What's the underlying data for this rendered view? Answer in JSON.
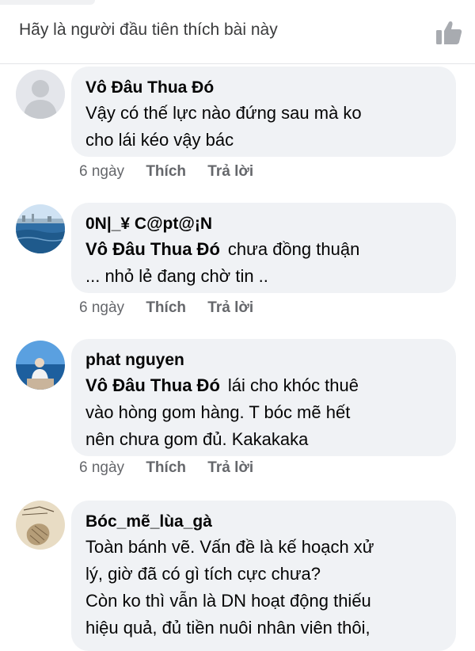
{
  "header": {
    "first_like_text": "Hãy là người đầu tiên thích bài này",
    "like_icon": "thumbs-up-icon"
  },
  "comments": [
    {
      "author": "Vô Đâu Thua Đó",
      "mention": "",
      "lines": [
        "Vậy có thế lực nào đứng sau mà ko",
        "cho lái kéo vậy bác"
      ],
      "time": "6 ngày",
      "like_label": "Thích",
      "reply_label": "Trả lời",
      "avatar_icon": "default-profile-icon"
    },
    {
      "author": "0N|_¥ C@pt@¡N",
      "mention": "Vô Đâu Thua Đó",
      "lines": [
        "chưa đồng thuận",
        "... nhỏ lẻ đang chờ tin .."
      ],
      "time": "6 ngày",
      "like_label": "Thích",
      "reply_label": "Trả lời",
      "avatar_icon": "sea-landscape-avatar"
    },
    {
      "author": "phat nguyen",
      "mention": "Vô Đâu Thua Đó",
      "lines": [
        "lái cho khóc thuê",
        "vào hòng gom hàng. T bóc mẽ hết",
        "nên chưa gom đủ. Kakakaka"
      ],
      "time": "6 ngày",
      "like_label": "Thích",
      "reply_label": "Trả lời",
      "avatar_icon": "person-by-sea-avatar"
    },
    {
      "author": "Bóc_mẽ_lùa_gà",
      "mention": "",
      "lines": [
        "Toàn bánh vẽ. Vấn đề là kế hoạch xử",
        "lý, giờ đã có gì tích cực chưa?",
        "Còn ko thì vẫn là DN hoạt động thiếu",
        "hiệu quả, đủ tiền nuôi nhân viên thôi,"
      ],
      "time": "",
      "like_label": "",
      "reply_label": "",
      "avatar_icon": "sketch-drawing-avatar"
    }
  ]
}
